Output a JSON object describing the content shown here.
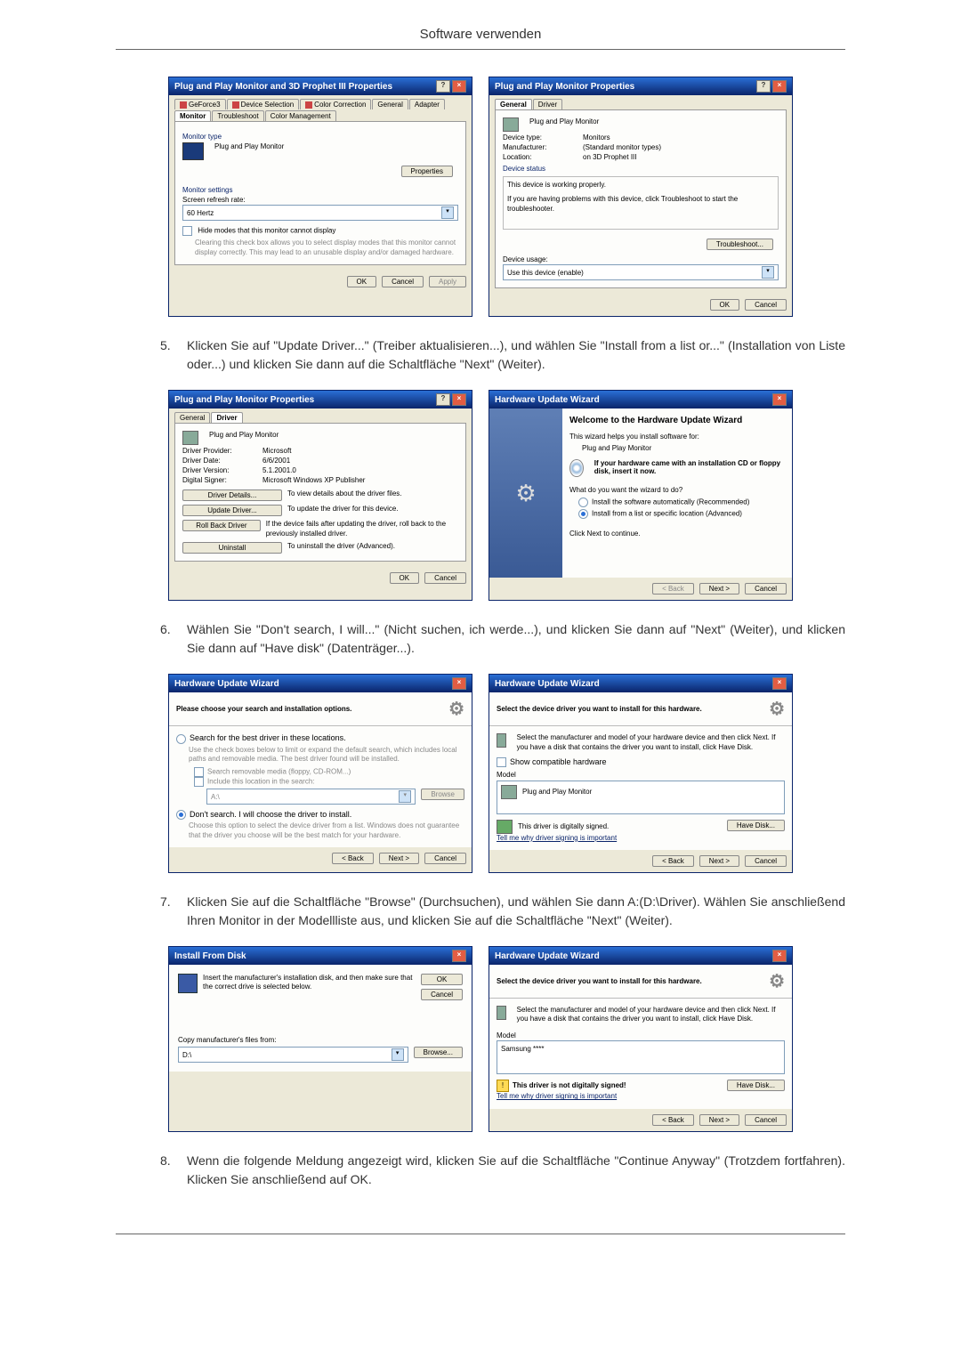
{
  "header": "Software verwenden",
  "steps": {
    "s5": {
      "num": "5.",
      "text": "Klicken Sie auf \"Update Driver...\" (Treiber aktualisieren...), und wählen Sie \"Install from a list or...\" (Installation von Liste oder...) und klicken Sie dann auf die Schaltfläche \"Next\" (Weiter)."
    },
    "s6": {
      "num": "6.",
      "text": "Wählen Sie \"Don't search, I will...\" (Nicht suchen, ich werde...), und klicken Sie dann auf \"Next\" (Weiter), und klicken Sie dann auf \"Have disk\" (Datenträger...)."
    },
    "s7": {
      "num": "7.",
      "text": "Klicken Sie auf die Schaltfläche \"Browse\" (Durchsuchen), und wählen Sie dann A:(D:\\Driver). Wählen Sie anschließend Ihren Monitor in der Modellliste aus, und klicken Sie auf die Schaltfläche \"Next\" (Weiter)."
    },
    "s8": {
      "num": "8.",
      "text": "Wenn die folgende Meldung angezeigt wird, klicken Sie auf die Schaltfläche \"Continue Anyway\" (Trotzdem fortfahren). Klicken Sie anschließend auf OK."
    }
  },
  "win1": {
    "title": "Plug and Play Monitor and 3D Prophet III Properties",
    "tabs": {
      "geforce": "GeForce3",
      "devsel": "Device Selection",
      "color": "Color Correction",
      "general": "General",
      "adapter": "Adapter",
      "monitor": "Monitor",
      "trouble": "Troubleshoot",
      "cmgmt": "Color Management"
    },
    "monitorType": "Monitor type",
    "monitorName": "Plug and Play Monitor",
    "propertiesBtn": "Properties",
    "monitorSettings": "Monitor settings",
    "refreshLabel": "Screen refresh rate:",
    "refreshValue": "60 Hertz",
    "hideModes": "Hide modes that this monitor cannot display",
    "hideNote": "Clearing this check box allows you to select display modes that this monitor cannot display correctly. This may lead to an unusable display and/or damaged hardware.",
    "ok": "OK",
    "cancel": "Cancel",
    "apply": "Apply"
  },
  "win2": {
    "title": "Plug and Play Monitor Properties",
    "tabs": {
      "general": "General",
      "driver": "Driver"
    },
    "name": "Plug and Play Monitor",
    "dtype": {
      "k": "Device type:",
      "v": "Monitors"
    },
    "manu": {
      "k": "Manufacturer:",
      "v": "(Standard monitor types)"
    },
    "loc": {
      "k": "Location:",
      "v": "on 3D Prophet III"
    },
    "statusLabel": "Device status",
    "statusText": "This device is working properly.",
    "statusNote": "If you are having problems with this device, click Troubleshoot to start the troubleshooter.",
    "troubleshoot": "Troubleshoot...",
    "usageLabel": "Device usage:",
    "usageValue": "Use this device (enable)",
    "ok": "OK",
    "cancel": "Cancel"
  },
  "win3": {
    "title": "Plug and Play Monitor Properties",
    "tabs": {
      "general": "General",
      "driver": "Driver"
    },
    "name": "Plug and Play Monitor",
    "provider": {
      "k": "Driver Provider:",
      "v": "Microsoft"
    },
    "date": {
      "k": "Driver Date:",
      "v": "6/6/2001"
    },
    "version": {
      "k": "Driver Version:",
      "v": "5.1.2001.0"
    },
    "signer": {
      "k": "Digital Signer:",
      "v": "Microsoft Windows XP Publisher"
    },
    "details": {
      "btn": "Driver Details...",
      "txt": "To view details about the driver files."
    },
    "update": {
      "btn": "Update Driver...",
      "txt": "To update the driver for this device."
    },
    "rollback": {
      "btn": "Roll Back Driver",
      "txt": "If the device fails after updating the driver, roll back to the previously installed driver."
    },
    "uninstall": {
      "btn": "Uninstall",
      "txt": "To uninstall the driver (Advanced)."
    },
    "ok": "OK",
    "cancel": "Cancel"
  },
  "win4": {
    "title": "Hardware Update Wizard",
    "welcome": "Welcome to the Hardware Update Wizard",
    "intro": "This wizard helps you install software for:",
    "device": "Plug and Play Monitor",
    "cd": "If your hardware came with an installation CD or floppy disk, insert it now.",
    "question": "What do you want the wizard to do?",
    "opt1": "Install the software automatically (Recommended)",
    "opt2": "Install from a list or specific location (Advanced)",
    "cont": "Click Next to continue.",
    "back": "< Back",
    "next": "Next >",
    "cancel": "Cancel"
  },
  "win5": {
    "title": "Hardware Update Wizard",
    "header": "Please choose your search and installation options.",
    "opt1": "Search for the best driver in these locations.",
    "opt1note": "Use the check boxes below to limit or expand the default search, which includes local paths and removable media. The best driver found will be installed.",
    "chk1": "Search removable media (floppy, CD-ROM...)",
    "chk2": "Include this location in the search:",
    "path": "A:\\",
    "browse": "Browse",
    "opt2": "Don't search. I will choose the driver to install.",
    "opt2note": "Choose this option to select the device driver from a list. Windows does not guarantee that the driver you choose will be the best match for your hardware.",
    "back": "< Back",
    "next": "Next >",
    "cancel": "Cancel"
  },
  "win6": {
    "title": "Hardware Update Wizard",
    "header": "Select the device driver you want to install for this hardware.",
    "note": "Select the manufacturer and model of your hardware device and then click Next. If you have a disk that contains the driver you want to install, click Have Disk.",
    "compat": "Show compatible hardware",
    "modelLabel": "Model",
    "model": "Plug and Play Monitor",
    "signed": "This driver is digitally signed.",
    "tell": "Tell me why driver signing is important",
    "havedisk": "Have Disk...",
    "back": "< Back",
    "next": "Next >",
    "cancel": "Cancel"
  },
  "win7": {
    "title": "Install From Disk",
    "note": "Insert the manufacturer's installation disk, and then make sure that the correct drive is selected below.",
    "ok": "OK",
    "cancel": "Cancel",
    "copyLabel": "Copy manufacturer's files from:",
    "path": "D:\\",
    "browse": "Browse..."
  },
  "win8": {
    "title": "Hardware Update Wizard",
    "header": "Select the device driver you want to install for this hardware.",
    "note": "Select the manufacturer and model of your hardware device and then click Next. If you have a disk that contains the driver you want to install, click Have Disk.",
    "modelLabel": "Model",
    "model": "Samsung ****",
    "warn": "This driver is not digitally signed!",
    "tell": "Tell me why driver signing is important",
    "havedisk": "Have Disk...",
    "back": "< Back",
    "next": "Next >",
    "cancel": "Cancel"
  }
}
